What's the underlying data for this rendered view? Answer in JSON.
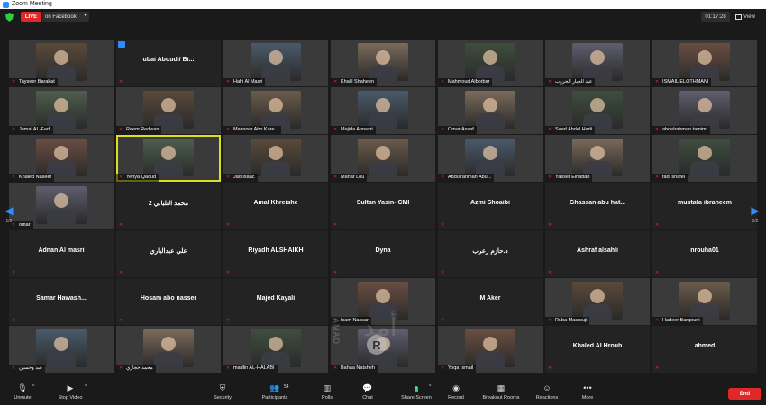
{
  "window": {
    "title": "Zoom Meeting"
  },
  "header": {
    "live_badge": "LIVE",
    "live_platform": "on Facebook",
    "timer": "01:17:28",
    "view_label": "View"
  },
  "grid": {
    "page_left": "1/2",
    "page_right": "1/2",
    "tiles": [
      {
        "name": "Tayseer Barakat",
        "video": true
      },
      {
        "name": "ubai Aboudi/ Bi...",
        "video": false,
        "big": true,
        "icon": true
      },
      {
        "name": "Hahi Al Masri",
        "video": true
      },
      {
        "name": "Khalil Shaheen",
        "video": true
      },
      {
        "name": "Mahmoud Alborbar",
        "video": true
      },
      {
        "name": "عبد الجبار الحروب",
        "video": true
      },
      {
        "name": "ISMAIL ELOTHMANI",
        "video": true
      },
      {
        "name": "Jamal AL-Fadi",
        "video": true
      },
      {
        "name": "Reem Redwan",
        "video": true
      },
      {
        "name": "Mansour Abo Kare...",
        "video": true
      },
      {
        "name": "Majida Almasri",
        "video": true
      },
      {
        "name": "Omar Assaf",
        "video": true
      },
      {
        "name": "Saad Abdel Hadi",
        "video": true
      },
      {
        "name": "abdelrahman tamimi",
        "video": true
      },
      {
        "name": "Khaled Naseef",
        "video": true
      },
      {
        "name": "Yehya Qaoud",
        "video": true,
        "active": true
      },
      {
        "name": "Jad Isaac",
        "video": true
      },
      {
        "name": "Manar Lou",
        "video": true
      },
      {
        "name": "Abdulrahman Abu...",
        "video": true
      },
      {
        "name": "Yasser Elhattab",
        "video": true
      },
      {
        "name": "fadi shafei",
        "video": true
      },
      {
        "name": "omar",
        "video": true
      },
      {
        "name": "محمد التلباني 2",
        "video": false,
        "big": true
      },
      {
        "name": "Amal Khreishe",
        "video": false,
        "big": true
      },
      {
        "name": "Sultan Yasin- CMI",
        "video": false,
        "big": true
      },
      {
        "name": "Azmi Shoaibi",
        "video": false,
        "big": true
      },
      {
        "name": "Ghassan abu hat...",
        "video": false,
        "big": true
      },
      {
        "name": "mustafa ibraheem",
        "video": false,
        "big": true
      },
      {
        "name": "Adnan Al masri",
        "video": false,
        "big": true
      },
      {
        "name": "علي عبدالباري",
        "video": false,
        "big": true
      },
      {
        "name": "Riyadh ALSHAIKH",
        "video": false,
        "big": true
      },
      {
        "name": "Dyna",
        "video": false,
        "big": true
      },
      {
        "name": "د.حازم زعرب",
        "video": false,
        "big": true
      },
      {
        "name": "Ashraf alsahli",
        "video": false,
        "big": true
      },
      {
        "name": "nrouha01",
        "video": false,
        "big": true
      },
      {
        "name": "Samar Hawash...",
        "video": false,
        "big": true
      },
      {
        "name": "Hosam abo nasser",
        "video": false,
        "big": true
      },
      {
        "name": "Majed Kayali",
        "video": false,
        "big": true
      },
      {
        "name": "Isam Nassar",
        "video": true
      },
      {
        "name": "M Aker",
        "video": false,
        "big": true
      },
      {
        "name": "Ruba Masrouji",
        "video": true
      },
      {
        "name": "Hadeer Barqouni",
        "video": true
      },
      {
        "name": "عبد وحسين",
        "video": true
      },
      {
        "name": "محمد حجازي",
        "video": true
      },
      {
        "name": "madlin AL-HALABI",
        "video": true
      },
      {
        "name": "Bahaa Natsheh",
        "video": true
      },
      {
        "name": "Yoqa Ismail",
        "video": true
      },
      {
        "name": "Khaled Al Hroub",
        "video": false,
        "big": true
      },
      {
        "name": "ahmed",
        "video": false,
        "big": true
      }
    ]
  },
  "watermark": {
    "arabic": "أمد",
    "latin": "AMAD",
    "letter": "R"
  },
  "toolbar": {
    "unmute": "Unmute",
    "stop_video": "Stop Video",
    "security": "Security",
    "participants": "Participants",
    "participants_count": "54",
    "polls": "Polls",
    "chat": "Chat",
    "share_screen": "Share Screen",
    "record": "Record",
    "breakout": "Breakout Rooms",
    "reactions": "Reactions",
    "more": "More",
    "end": "End"
  },
  "colors": {
    "accent": "#2d8cff",
    "live": "#e02828",
    "share": "#23c36a",
    "active_border": "#d9e021"
  }
}
